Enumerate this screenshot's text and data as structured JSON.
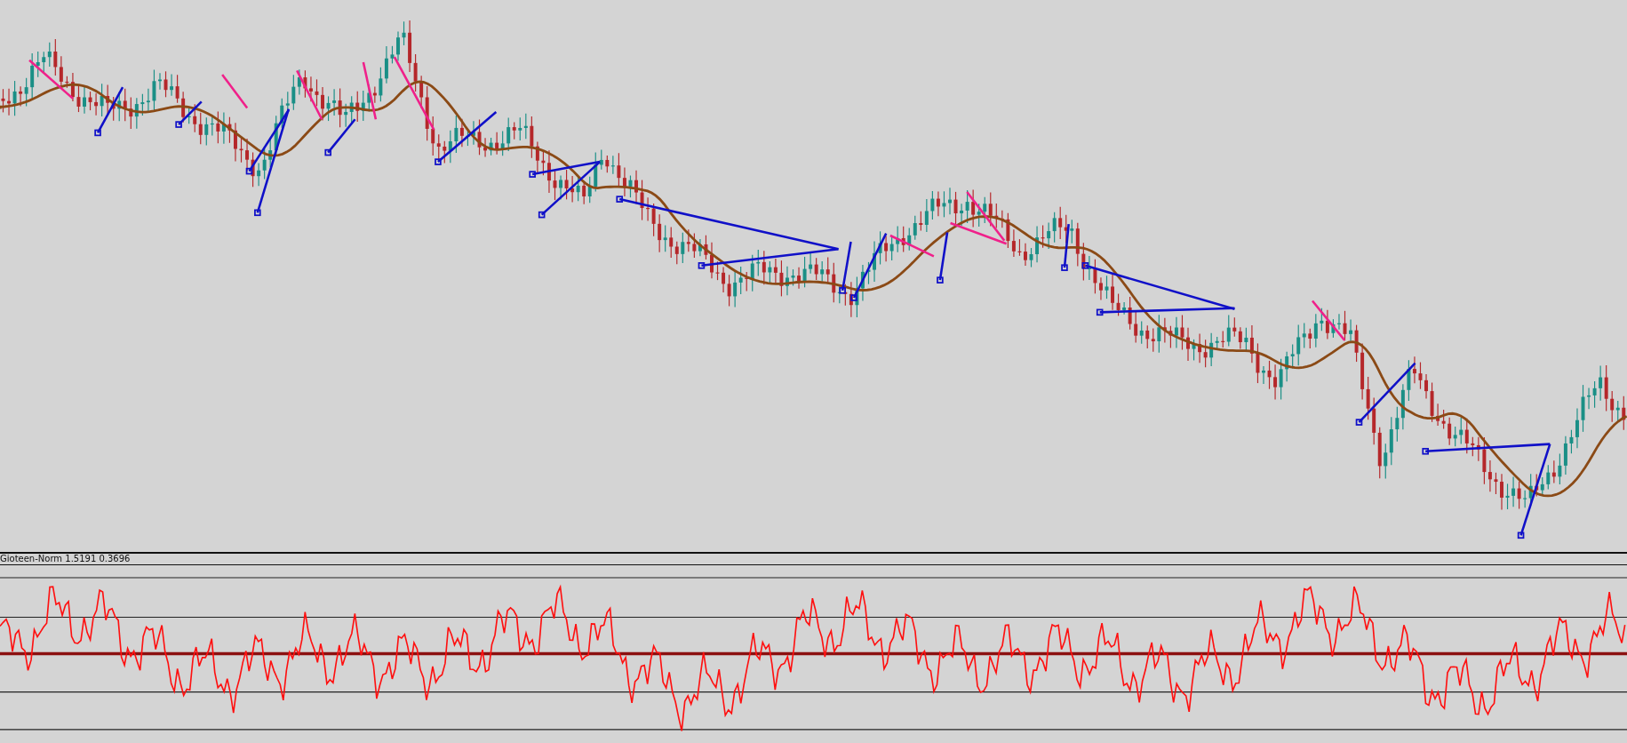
{
  "indicator": {
    "label": "Gioteen-Norm 1.5191 0.3696"
  }
}
